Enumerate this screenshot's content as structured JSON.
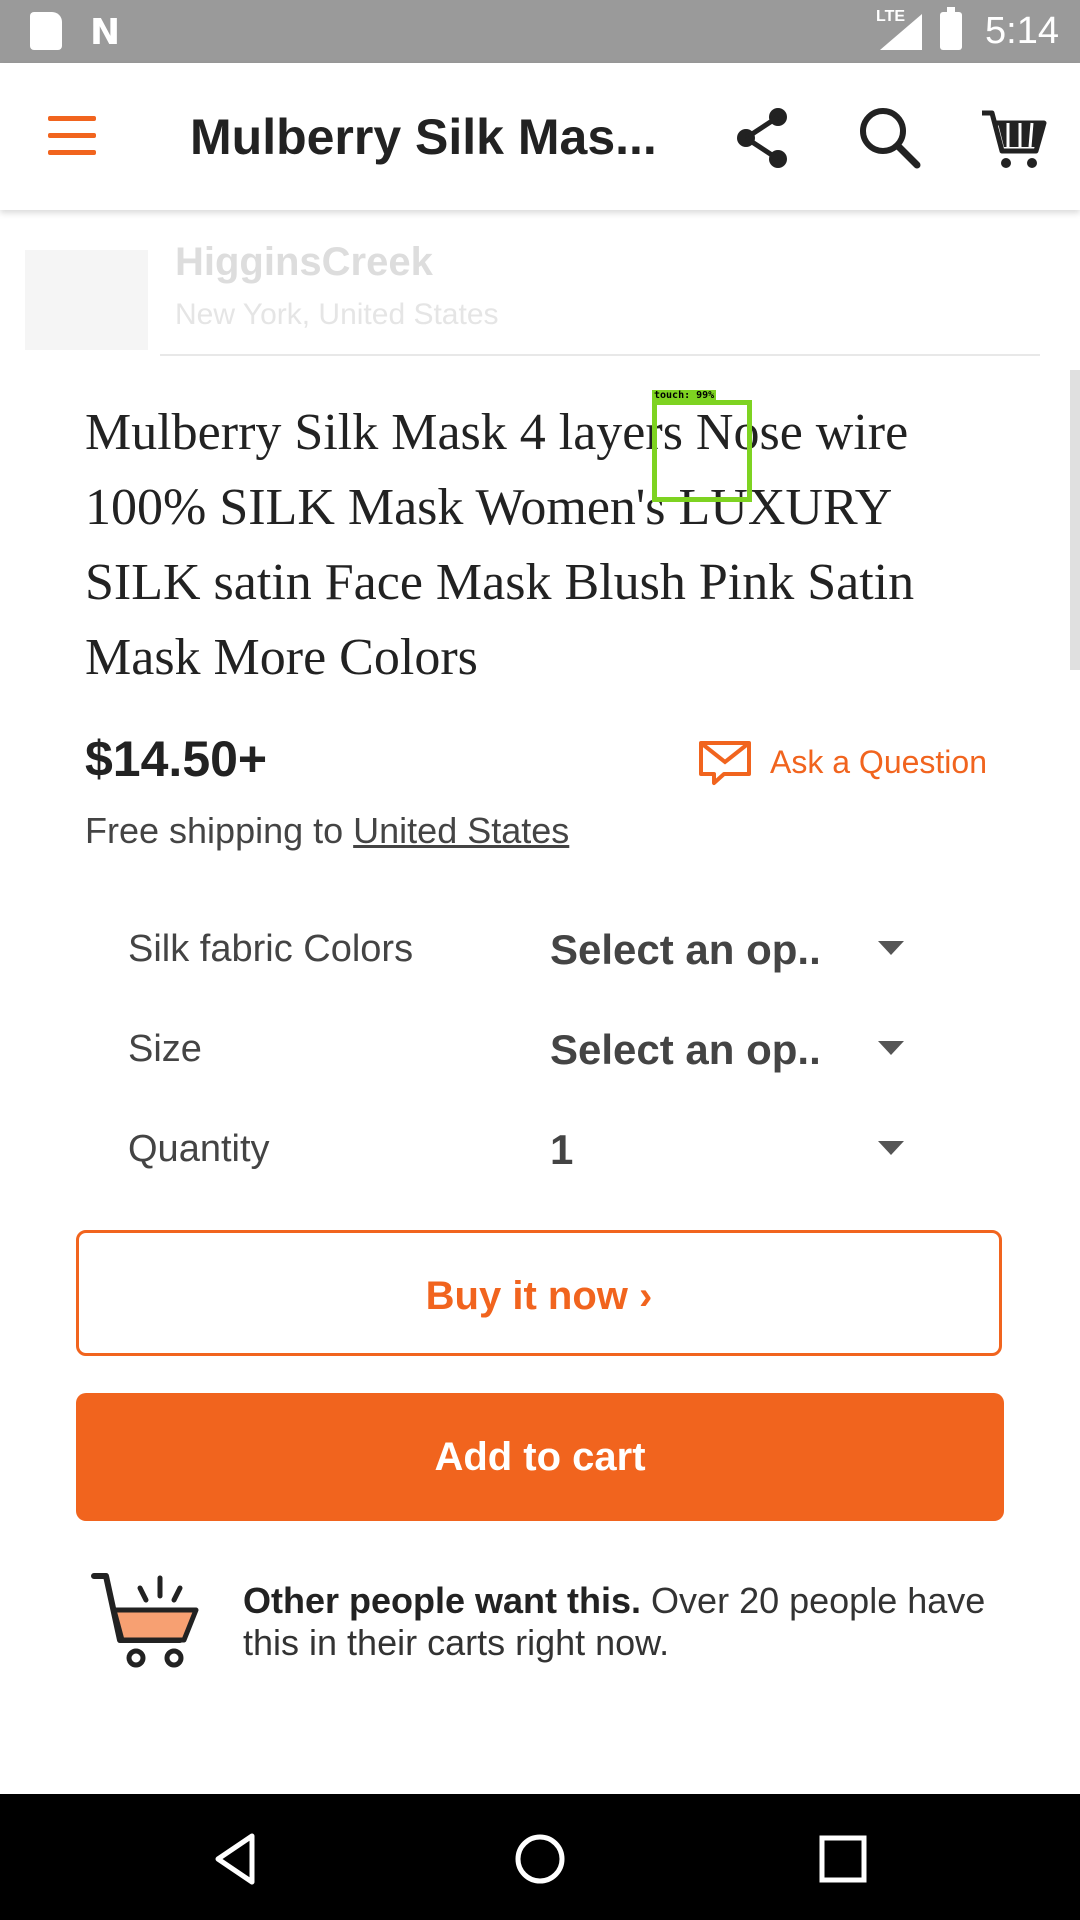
{
  "status_bar": {
    "network": "LTE",
    "time": "5:14"
  },
  "toolbar": {
    "title": "Mulberry Silk Mas..."
  },
  "background": {
    "shop_name": "HigginsCreek",
    "shop_location": "New York, United States"
  },
  "product": {
    "title": "Mulberry Silk Mask 4 layers Nose wire 100% SILK Mask Women's LUXURY SILK satin Face Mask Blush Pink Satin Mask More Colors",
    "price": "$14.50+",
    "ask_question": "Ask a Question",
    "shipping_prefix": "Free shipping to ",
    "shipping_country": "United States"
  },
  "options": [
    {
      "label": "Silk fabric Colors",
      "value": "Select an op.."
    },
    {
      "label": "Size",
      "value": "Select an op.."
    },
    {
      "label": "Quantity",
      "value": "1"
    }
  ],
  "buttons": {
    "buy_now": "Buy it now ›",
    "add_to_cart": "Add to cart"
  },
  "demand": {
    "bold": "Other people want this.",
    "text": " Over 20 people have this in their carts right now."
  },
  "touch_indicator": "touch: 99%",
  "colors": {
    "accent": "#f1641e",
    "touch": "#7ed321"
  }
}
